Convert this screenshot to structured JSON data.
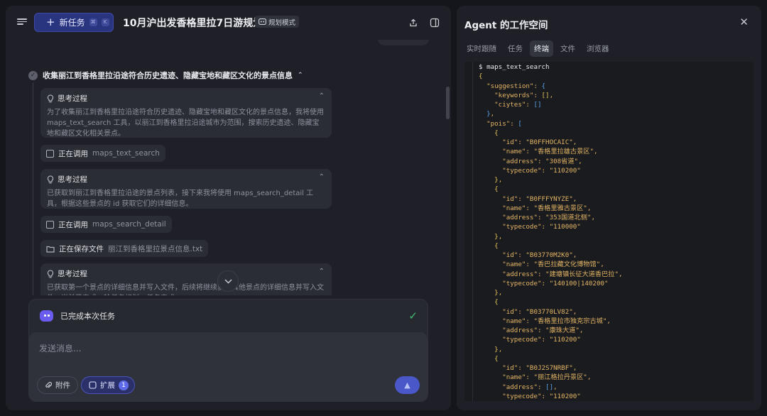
{
  "header": {
    "new_task_label": "新任务",
    "kbd1": "⌘",
    "kbd2": "K",
    "title": "10月沪出发香格里拉7日游规划",
    "mode_label": "规划模式"
  },
  "step": {
    "title": "收集丽江到香格里拉沿途符合历史遗迹、隐藏宝地和藏区文化的景点信息",
    "caret": "^"
  },
  "feed": [
    {
      "kind": "think",
      "title": "思考过程",
      "body": "为了收集丽江到香格里拉沿途符合历史遗迹、隐藏宝地和藏区文化的景点信息，我将使用 maps_text_search 工具，以丽江到香格里拉沿途城市为范围，搜索历史遗迹、隐藏宝地和藏区文化相关景点。"
    },
    {
      "kind": "call",
      "label": "正在调用",
      "sub": "maps_text_search"
    },
    {
      "kind": "think",
      "title": "思考过程",
      "body": "已获取到丽江到香格里拉沿途的景点列表，接下来我将使用 maps_search_detail 工具，根据这些景点的 id 获取它们的详细信息。"
    },
    {
      "kind": "call",
      "label": "正在调用",
      "sub": "maps_search_detail"
    },
    {
      "kind": "file",
      "label": "正在保存文件",
      "sub": "丽江到香格里拉景点信息.txt"
    },
    {
      "kind": "think",
      "title": "思考过程",
      "body": "已获取第一个景点的详细信息并写入文件，后续将继续获取其他景点的详细信息并写入文件，当前已完成一轮任务规划，任务完成。"
    }
  ],
  "composer": {
    "done_label": "已完成本次任务",
    "placeholder": "发送消息...",
    "attach_label": "附件",
    "extend_label": "扩展",
    "extend_count": "1"
  },
  "workspace": {
    "title": "Agent 的工作空间",
    "tabs": [
      "实时跟随",
      "任务",
      "终端",
      "文件",
      "浏览器"
    ],
    "active_tab": "终端",
    "command": "$ maps_text_search",
    "pois": [
      {
        "id": "B0FFHOCAIC",
        "name": "香格里拉雄古景区",
        "address": "308省道",
        "typecode": "110200"
      },
      {
        "id": "B0FFFYNYZE",
        "name": "香格里雅古景区",
        "address": "353国道北侧",
        "typecode": "110000"
      },
      {
        "id": "B03770M2K0",
        "name": "香巴拉藏文化博物馆",
        "address": "建塘镇长征大道香巴拉",
        "typecode": "140100|140200"
      },
      {
        "id": "B03770LV82",
        "name": "香格里拉市独克宗古城",
        "address": "康珠大道",
        "typecode": "110200"
      },
      {
        "id": "B0J2S7NRBF",
        "name": "丽江格拉丹景区",
        "address": "[]",
        "typecode": "110200"
      }
    ]
  },
  "colors": {
    "accent": "#4a57c8",
    "success": "#3fbf72",
    "json_key": "#e3b464",
    "json_bracket": "#5aa0e6"
  }
}
